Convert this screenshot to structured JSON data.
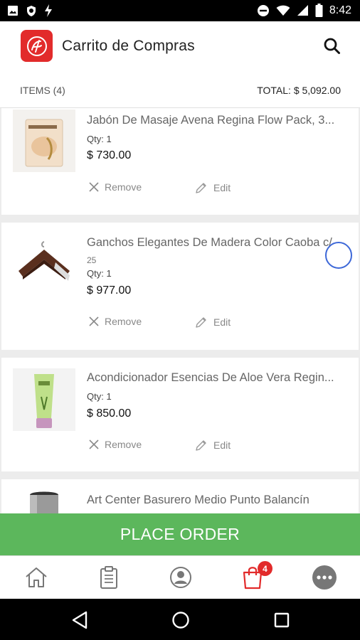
{
  "status_bar": {
    "time": "8:42"
  },
  "app_bar": {
    "title": "Carrito de Compras",
    "logo_icon": "brand-logo-icon",
    "search_icon": "search-icon"
  },
  "summary": {
    "items_label": "ITEMS (4)",
    "total_label": "TOTAL: $  5,092.00"
  },
  "cart": {
    "items": [
      {
        "name": "Jabón De Masaje Avena Regina Flow Pack, 3...",
        "sub": "",
        "qty": "Qty: 1",
        "price": "$  730.00",
        "remove": "Remove",
        "edit": "Edit",
        "thumb": "soap-package-image"
      },
      {
        "name": "Ganchos Elegantes De Madera Color Caoba c/",
        "sub": "25",
        "qty": "Qty: 1",
        "price": "$  977.00",
        "remove": "Remove",
        "edit": "Edit",
        "thumb": "wooden-hangers-image"
      },
      {
        "name": "Acondicionador Esencias De Aloe Vera Regin...",
        "sub": "",
        "qty": "Qty: 1",
        "price": "$  850.00",
        "remove": "Remove",
        "edit": "Edit",
        "thumb": "conditioner-tube-image"
      },
      {
        "name": "Art Center Basurero Medio Punto Balancín",
        "sub": "",
        "qty": "",
        "price": "",
        "remove": "",
        "edit": "",
        "thumb": "trash-bin-image"
      }
    ]
  },
  "place_order": {
    "label": "PLACE ORDER",
    "color": "#5cb75c"
  },
  "bottom_nav": {
    "items": [
      {
        "icon": "home-icon"
      },
      {
        "icon": "clipboard-icon"
      },
      {
        "icon": "account-icon"
      },
      {
        "icon": "shopping-bag-icon",
        "badge": "4"
      },
      {
        "icon": "more-icon"
      }
    ]
  },
  "colors": {
    "brand": "#e22b2b",
    "accent_green": "#5cb75c"
  }
}
